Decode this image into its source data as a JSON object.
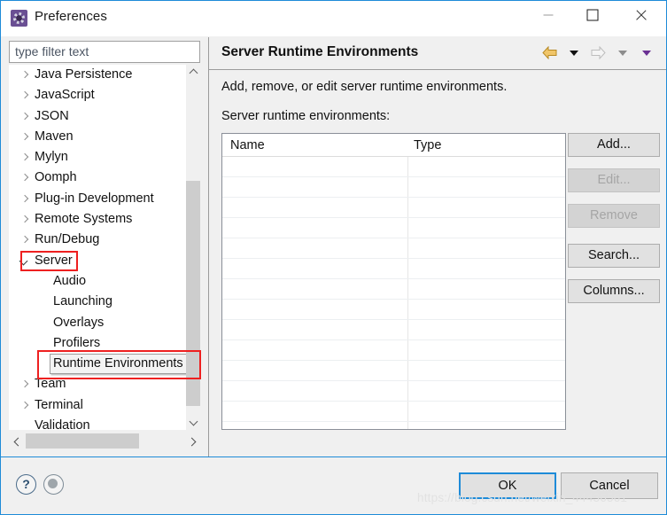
{
  "window": {
    "title": "Preferences",
    "icon": "preferences-gear-icon",
    "controls": {
      "minimize": "minimize-icon",
      "maximize": "maximize-icon",
      "close": "close-icon"
    }
  },
  "filter": {
    "placeholder": "type filter text",
    "value": ""
  },
  "tree": {
    "items": [
      {
        "label": "Java Persistence",
        "level": 1,
        "twisty": "collapsed"
      },
      {
        "label": "JavaScript",
        "level": 1,
        "twisty": "collapsed"
      },
      {
        "label": "JSON",
        "level": 1,
        "twisty": "collapsed"
      },
      {
        "label": "Maven",
        "level": 1,
        "twisty": "collapsed"
      },
      {
        "label": "Mylyn",
        "level": 1,
        "twisty": "collapsed"
      },
      {
        "label": "Oomph",
        "level": 1,
        "twisty": "collapsed"
      },
      {
        "label": "Plug-in Development",
        "level": 1,
        "twisty": "collapsed"
      },
      {
        "label": "Remote Systems",
        "level": 1,
        "twisty": "collapsed"
      },
      {
        "label": "Run/Debug",
        "level": 1,
        "twisty": "collapsed"
      },
      {
        "label": "Server",
        "level": 1,
        "twisty": "expanded",
        "highlighted": true
      },
      {
        "label": "Audio",
        "level": 2,
        "twisty": "none"
      },
      {
        "label": "Launching",
        "level": 2,
        "twisty": "none"
      },
      {
        "label": "Overlays",
        "level": 2,
        "twisty": "none"
      },
      {
        "label": "Profilers",
        "level": 2,
        "twisty": "none"
      },
      {
        "label": "Runtime Environments",
        "level": 2,
        "twisty": "none",
        "selected": true,
        "highlighted": true
      },
      {
        "label": "Team",
        "level": 1,
        "twisty": "collapsed"
      },
      {
        "label": "Terminal",
        "level": 1,
        "twisty": "collapsed"
      },
      {
        "label": "Validation",
        "level": 1,
        "twisty": "none"
      }
    ]
  },
  "detail": {
    "title": "Server Runtime Environments",
    "description": "Add, remove, or edit server runtime environments.",
    "sublabel": "Server runtime environments:",
    "nav": {
      "back_icon": "back-arrow-icon",
      "back_menu_icon": "chevron-down-icon",
      "forward_icon": "forward-arrow-icon",
      "forward_menu_icon": "chevron-down-icon",
      "view_menu_icon": "chevron-down-icon"
    },
    "table": {
      "columns": [
        "Name",
        "Type"
      ],
      "rows": [],
      "empty_row_count": 13
    },
    "buttons": [
      {
        "label": "Add...",
        "enabled": true
      },
      {
        "label": "Edit...",
        "enabled": false
      },
      {
        "label": "Remove",
        "enabled": false
      },
      {
        "label": "Search...",
        "enabled": true
      },
      {
        "label": "Columns...",
        "enabled": true
      }
    ]
  },
  "footer": {
    "help_icon": "?",
    "help_icon_name": "help-icon",
    "apply_icon_name": "apply-defaults-icon",
    "ok_label": "OK",
    "cancel_label": "Cancel"
  },
  "watermark": "https://blog.csdn.net/weixin_44436561",
  "colors": {
    "accent": "#1e8bd8",
    "annotation": "#ee2020",
    "title_icon": "#6a4f93",
    "back_arrow": "#e0a93a",
    "forward_arrow": "#c9c9c9"
  }
}
